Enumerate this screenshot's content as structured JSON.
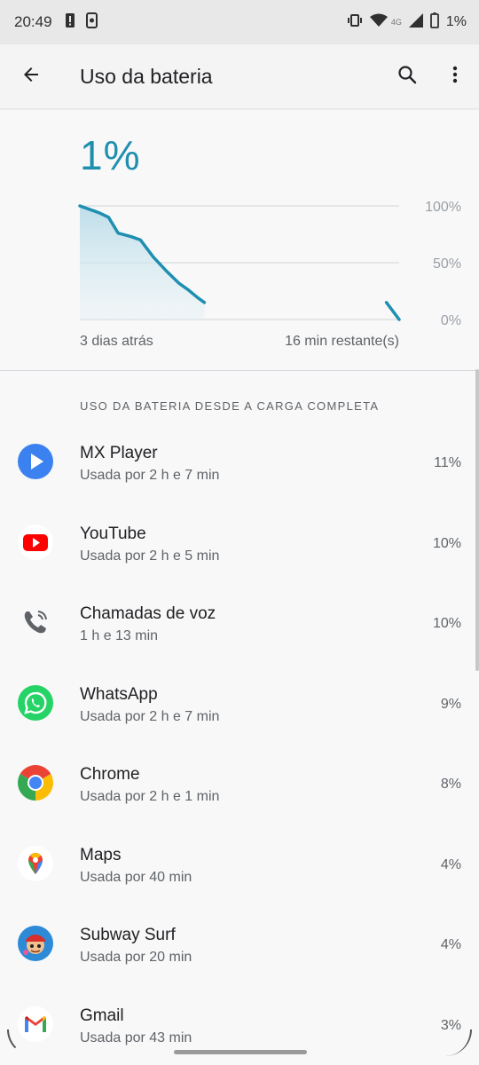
{
  "status_bar": {
    "time": "20:49",
    "network": "4G",
    "battery_text": "1%"
  },
  "app_bar": {
    "title": "Uso da bateria",
    "back_icon": "arrow-back-icon",
    "search_icon": "search-icon",
    "menu_icon": "more-vert-icon"
  },
  "battery": {
    "level_text": "1%",
    "accent_color": "#1e8fb0"
  },
  "chart_data": {
    "type": "line",
    "y_ticks": [
      "100%",
      "50%",
      "0%"
    ],
    "ylim": [
      0,
      100
    ],
    "x_left_label": "3 dias atrás",
    "x_right_label": "16 min restante(s)",
    "series": [
      {
        "values": [
          {
            "x": 0,
            "y": 100
          },
          {
            "x": 0.06,
            "y": 94
          },
          {
            "x": 0.09,
            "y": 90
          },
          {
            "x": 0.12,
            "y": 76
          },
          {
            "x": 0.16,
            "y": 73
          },
          {
            "x": 0.19,
            "y": 70
          },
          {
            "x": 0.23,
            "y": 55
          },
          {
            "x": 0.27,
            "y": 43
          },
          {
            "x": 0.31,
            "y": 32
          },
          {
            "x": 0.34,
            "y": 26
          },
          {
            "x": 0.37,
            "y": 19
          },
          {
            "x": 0.39,
            "y": 15
          }
        ]
      },
      {
        "values": [
          {
            "x": 0.96,
            "y": 15
          },
          {
            "x": 1.0,
            "y": 0
          }
        ]
      }
    ]
  },
  "section_header": "USO DA BATERIA DESDE A CARGA COMPLETA",
  "apps": [
    {
      "name": "MX Player",
      "usage": "Usada por 2 h e 7 min",
      "percent": "11%",
      "icon": "mx-player-icon"
    },
    {
      "name": "YouTube",
      "usage": "Usada por 2 h e 5 min",
      "percent": "10%",
      "icon": "youtube-icon"
    },
    {
      "name": "Chamadas de voz",
      "usage": "1 h e 13 min",
      "percent": "10%",
      "icon": "phone-call-icon"
    },
    {
      "name": "WhatsApp",
      "usage": "Usada por 2 h e 7 min",
      "percent": "9%",
      "icon": "whatsapp-icon"
    },
    {
      "name": "Chrome",
      "usage": "Usada por 2 h e 1 min",
      "percent": "8%",
      "icon": "chrome-icon"
    },
    {
      "name": "Maps",
      "usage": "Usada por 40 min",
      "percent": "4%",
      "icon": "maps-icon"
    },
    {
      "name": "Subway Surf",
      "usage": "Usada por 20 min",
      "percent": "4%",
      "icon": "subway-surf-icon"
    },
    {
      "name": "Gmail",
      "usage": "Usada por 43 min",
      "percent": "3%",
      "icon": "gmail-icon"
    }
  ]
}
